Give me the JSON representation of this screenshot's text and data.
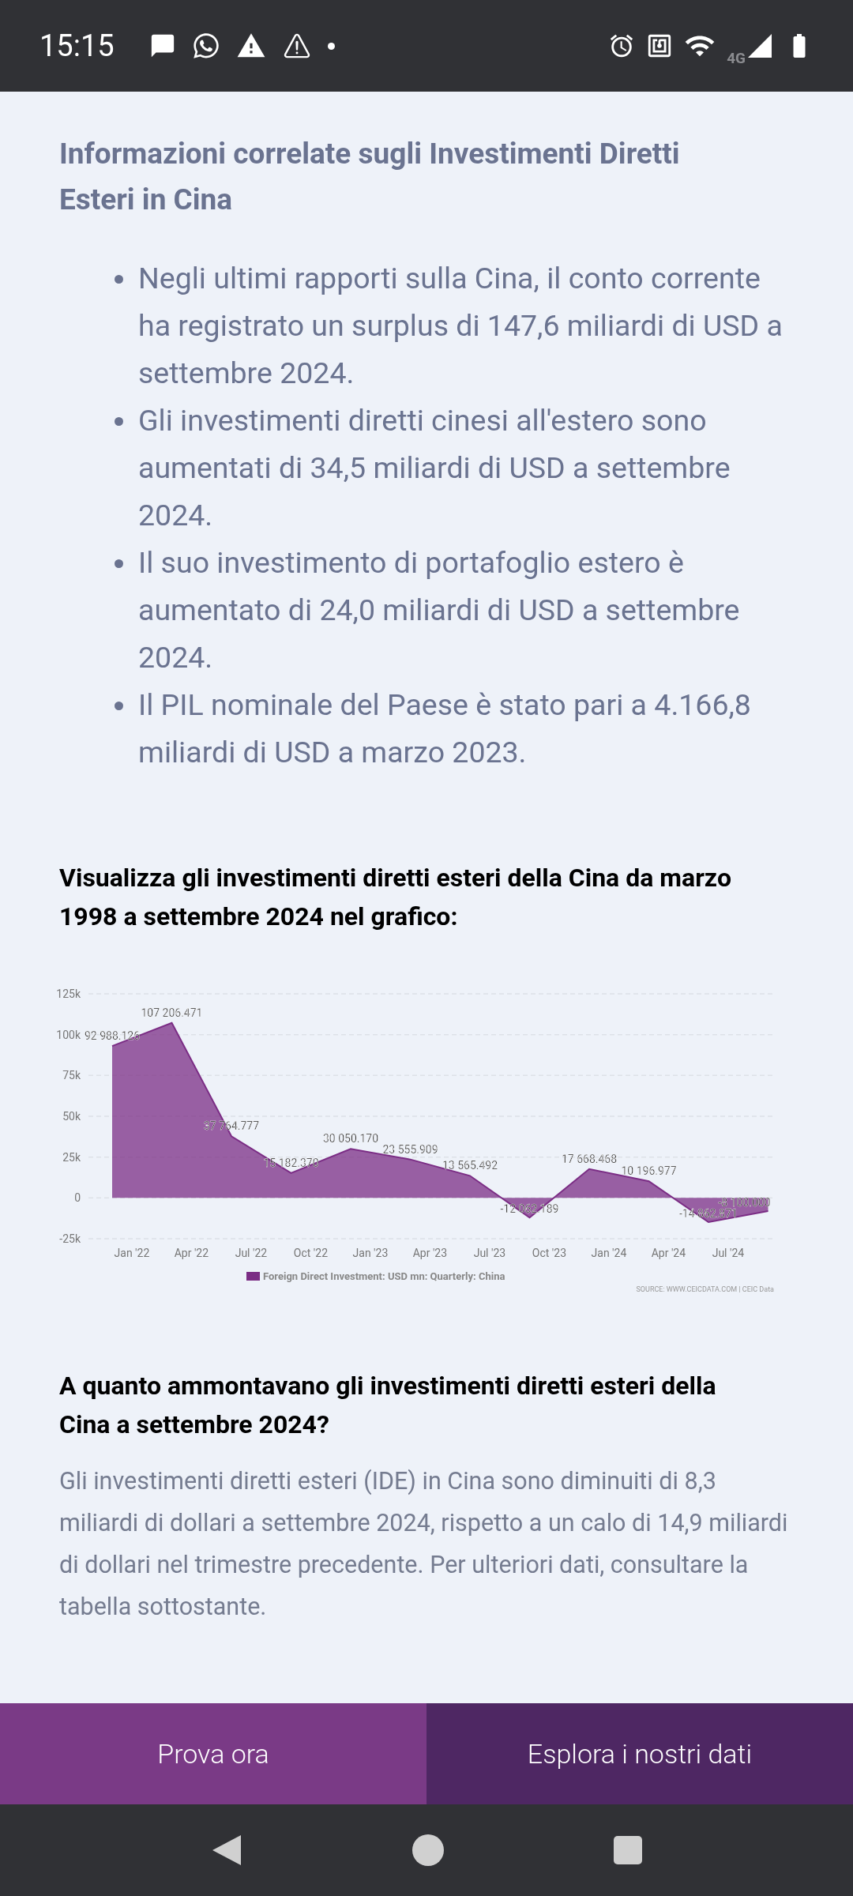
{
  "status_bar": {
    "time": "15:15",
    "network": "4G"
  },
  "related": {
    "title": "Informazioni correlate sugli Investimenti Diretti Esteri in Cina",
    "bullets": [
      "Negli ultimi rapporti sulla Cina, il conto corrente ha registrato un surplus di 147,6 miliardi di USD a settembre 2024.",
      "Gli investimenti diretti cinesi all'estero sono aumentati di 34,5 miliardi di USD a settembre 2024.",
      "Il suo investimento di portafoglio estero è aumentato di 24,0 miliardi di USD a settembre 2024.",
      "Il PIL nominale del Paese è stato pari a 4.166,8 miliardi di USD a marzo 2023."
    ]
  },
  "chart_section": {
    "title": "Visualizza gli investimenti diretti esteri della Cina da marzo 1998 a settembre 2024 nel grafico:",
    "source": "SOURCE: WWW.CEICDATA.COM | CEIC Data",
    "chart_data": {
      "type": "area",
      "grid": true,
      "categories": [
        "Jan '22",
        "Apr '22",
        "Jul '22",
        "Oct '22",
        "Jan '23",
        "Apr '23",
        "Jul '23",
        "Oct '23",
        "Jan '24",
        "Apr '24",
        "Jul '24",
        null
      ],
      "series": [
        {
          "name": "Foreign Direct Investment: USD mn: Quarterly: China",
          "color": "#7b2d85",
          "values": [
            92988.126,
            107206.471,
            37764.777,
            15182.37,
            30050.17,
            23555.909,
            13565.492,
            -12062.189,
            17668.468,
            10196.977,
            -14862.871,
            -8100
          ]
        }
      ],
      "value_labels": [
        "92 988.126",
        "107 206.471",
        "37 764.777",
        "15 182.370",
        "30 050.170",
        "23 555.909",
        "13 565.492",
        "-12 062.189",
        "17 668.468",
        "10 196.977",
        "-14 862.871",
        "-8 100.000"
      ],
      "ylim": [
        -25000,
        125000
      ],
      "yticks": [
        {
          "value": -25000,
          "label": "-25k"
        },
        {
          "value": 0,
          "label": "0"
        },
        {
          "value": 25000,
          "label": "25k"
        },
        {
          "value": 50000,
          "label": "50k"
        },
        {
          "value": 75000,
          "label": "75k"
        },
        {
          "value": 100000,
          "label": "100k"
        },
        {
          "value": 125000,
          "label": "125k"
        }
      ]
    }
  },
  "question": {
    "title": "A quanto ammontavano gli investimenti diretti esteri della Cina a settembre 2024?",
    "text": "Gli investimenti diretti esteri (IDE) in Cina sono diminuiti di 8,3 miliardi di dollari a settembre 2024, rispetto a un calo di 14,9 miliardi di dollari nel trimestre precedente. Per ulteriori dati, consultare la tabella sottostante."
  },
  "buttons": [
    {
      "label": "Prova ora",
      "kind": "primary"
    },
    {
      "label": "Esplora i nostri dati",
      "kind": "secondary"
    }
  ]
}
